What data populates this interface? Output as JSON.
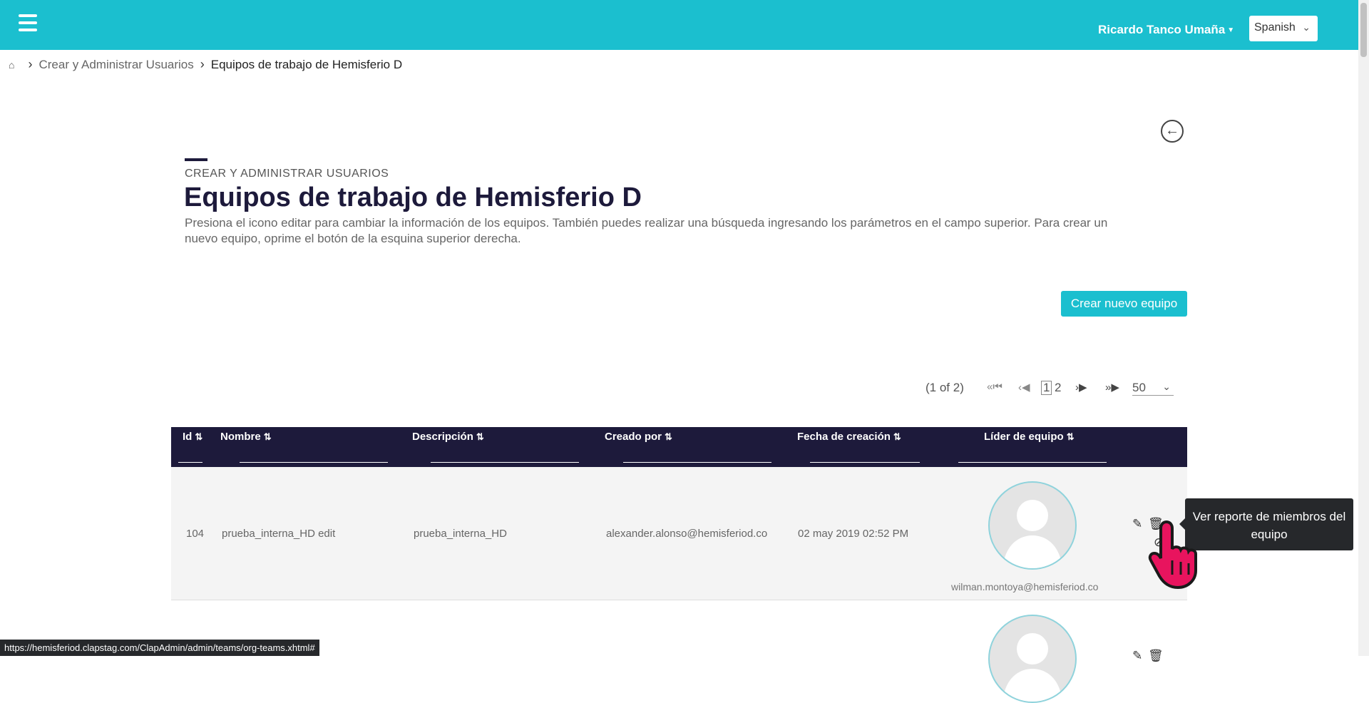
{
  "header": {
    "user_name": "Ricardo Tanco Umaña",
    "language": "Spanish"
  },
  "breadcrumb": {
    "item1": "Crear y Administrar Usuarios",
    "current": "Equipos de trabajo de Hemisferio D"
  },
  "page": {
    "eyebrow": "CREAR Y ADMINISTRAR USUARIOS",
    "title": "Equipos de trabajo de Hemisferio D",
    "description": "Presiona el icono editar para cambiar la información de los equipos. También puedes realizar una búsqueda ingresando los parámetros en el campo superior. Para crear un nuevo equipo, oprime el botón de la esquina superior derecha.",
    "create_button": "Crear nuevo equipo"
  },
  "paginator": {
    "report": "(1 of 2)",
    "current_page": "1",
    "next_page": "2",
    "rows_per_page": "50"
  },
  "table": {
    "columns": [
      "Id",
      "Nombre",
      "Descripción",
      "Creado por",
      "Fecha de creación",
      "Líder de equipo"
    ],
    "rows": [
      {
        "id": "104",
        "nombre": "prueba_interna_HD edit",
        "descripcion": "prueba_interna_HD",
        "creado_por": "alexander.alonso@hemisferiod.co",
        "fecha": "02 may 2019 02:52 PM",
        "lider": "wilman.montoya@hemisferiod.co"
      }
    ]
  },
  "tooltip": "Ver reporte de miembros del equipo",
  "status_url": "https://hemisferiod.clapstag.com/ClapAdmin/admin/teams/org-teams.xhtml#",
  "colors": {
    "accent": "#1bbfcf",
    "header_dark": "#1d1a3b",
    "cursor_pink": "#e8145e"
  }
}
